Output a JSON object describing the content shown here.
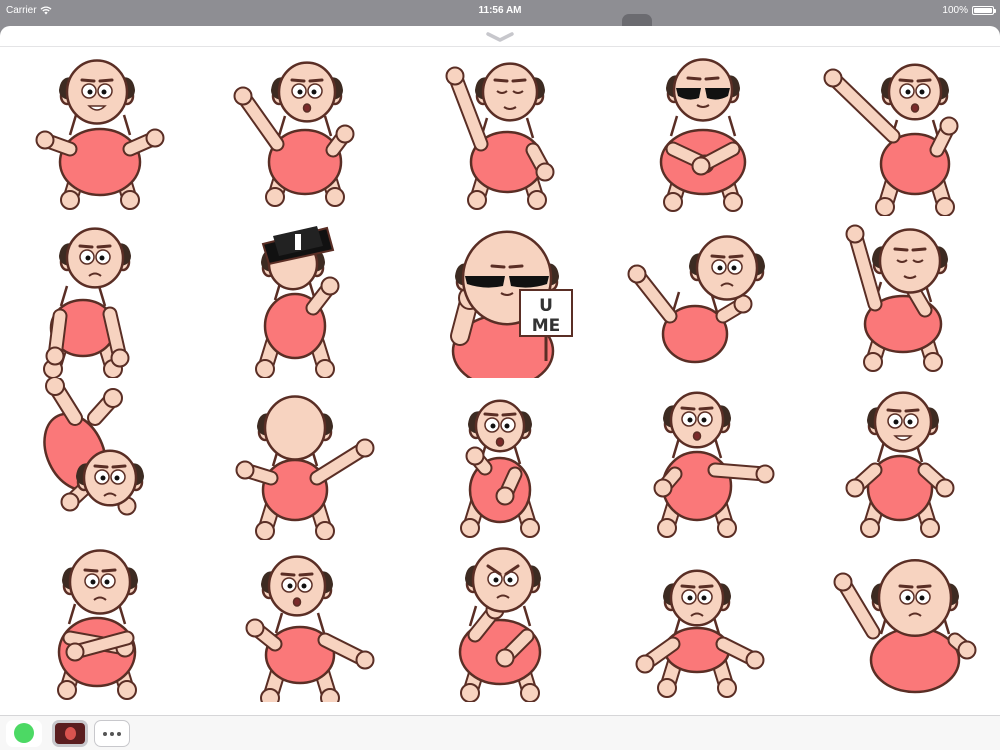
{
  "status_bar": {
    "carrier": "Carrier",
    "time": "11:56 AM",
    "battery": "100%"
  },
  "colors": {
    "skin": "#f7d3c0",
    "suit": "#fa7879",
    "outline": "#5a2e25",
    "hair": "#3d2b22",
    "recents_green": "#4cd964"
  },
  "sticker_grid": {
    "columns": 5,
    "stickers": [
      {
        "name": "sticker-grin-crouch",
        "pose": "grin"
      },
      {
        "name": "sticker-wave-hello",
        "pose": "wave"
      },
      {
        "name": "sticker-rock-on-smug",
        "pose": "rockon"
      },
      {
        "name": "sticker-cool-sunglasses",
        "pose": "shades"
      },
      {
        "name": "sticker-point-up-dance",
        "pose": "pointleft"
      },
      {
        "name": "sticker-frown-crouch",
        "pose": "frown"
      },
      {
        "name": "sticker-top-hat-back",
        "pose": "tophat"
      },
      {
        "name": "sticker-u-or-me-sign",
        "pose": "sign",
        "sign_text": [
          "U",
          "ME"
        ]
      },
      {
        "name": "sticker-pensive-peace",
        "pose": "peace"
      },
      {
        "name": "sticker-nose-blow",
        "pose": "nose"
      },
      {
        "name": "sticker-headstand",
        "pose": "headstand"
      },
      {
        "name": "sticker-back-turned-dance",
        "pose": "dance"
      },
      {
        "name": "sticker-thumbs-up",
        "pose": "thumbs"
      },
      {
        "name": "sticker-point-right",
        "pose": "point"
      },
      {
        "name": "sticker-grin-hands-hips",
        "pose": "hips"
      },
      {
        "name": "sticker-arms-crossed-frown",
        "pose": "crossed"
      },
      {
        "name": "sticker-leg-kick",
        "pose": "kick"
      },
      {
        "name": "sticker-angry-nose-hold",
        "pose": "angry"
      },
      {
        "name": "sticker-shrug-shocked",
        "pose": "shrug"
      },
      {
        "name": "sticker-finger-up-stern",
        "pose": "fingerup"
      }
    ]
  },
  "app_drawer": {
    "apps": [
      "recents-icon",
      "sticker-app-icon",
      "more-apps-icon"
    ]
  }
}
